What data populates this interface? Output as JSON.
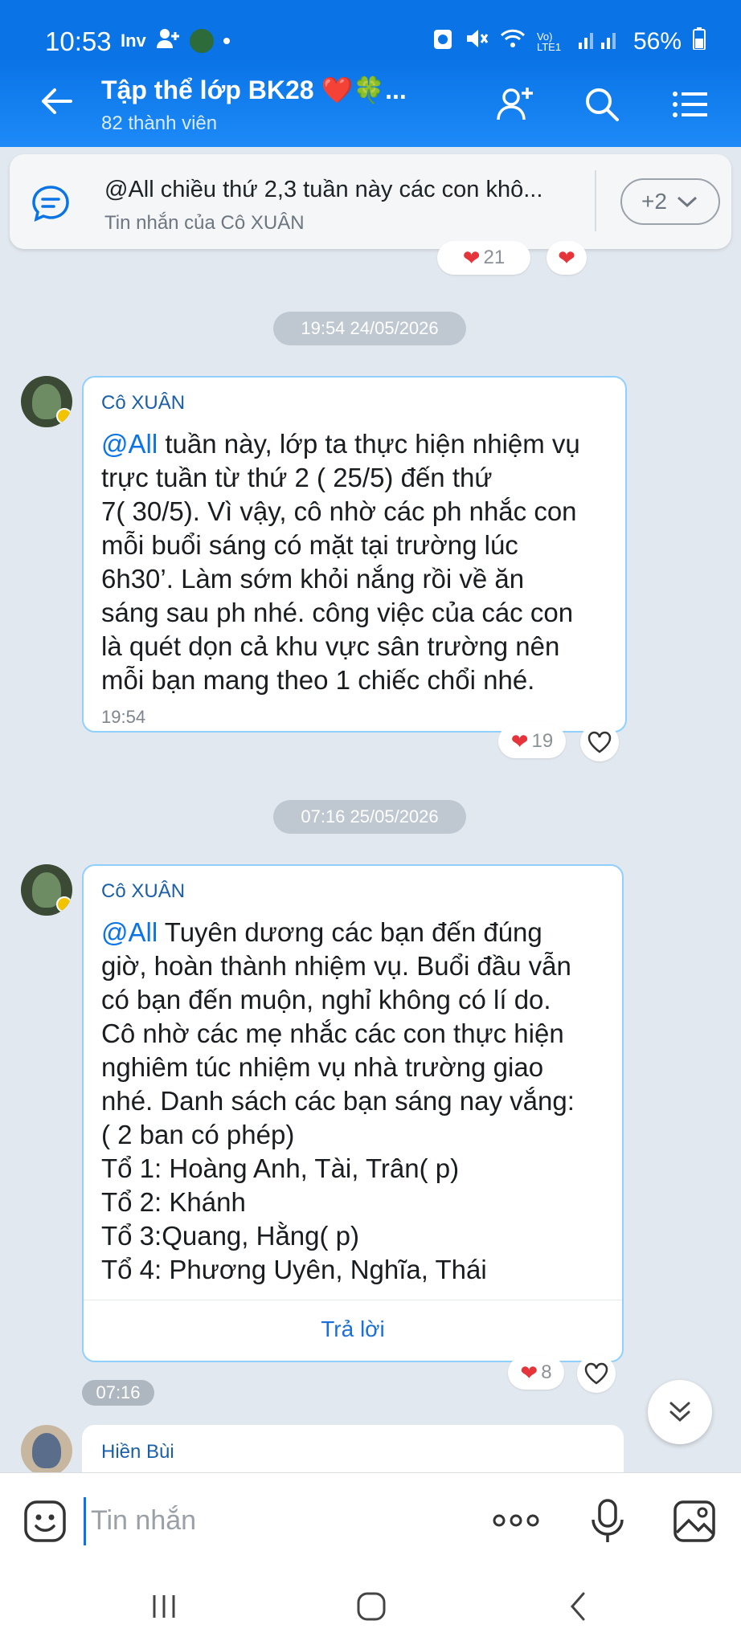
{
  "status_bar": {
    "time": "10:53",
    "left_text": "Inv",
    "right_text": "56%",
    "net_label": "Vo) LTE1"
  },
  "app_bar": {
    "title": "Tập thể lớp BK28 ❤️🍀...",
    "subtitle": "82 thành viên"
  },
  "pinned": {
    "text": "@All chiều thứ 2,3 tuần này các con khô...",
    "source": "Tin nhắn của Cô XUÂN",
    "more_label": "+2"
  },
  "top_reaction": {
    "count": "21"
  },
  "messages": [
    {
      "date": "19:54 24/05/2026",
      "sender": "Cô XUÂN",
      "mention": "@All",
      "text": " tuần này, lớp ta thực hiện nhiệm vụ\ntrực tuần từ thứ 2 ( 25/5) đến thứ\n7( 30/5). Vì vậy, cô nhờ các ph nhắc con\nmỗi buổi sáng có mặt tại trường lúc\n6h30’. Làm sớm khỏi nắng rồi về ăn\nsáng sau ph nhé. công việc của các con\nlà quét dọn cả khu vực sân trường nên\nmỗi bạn mang theo 1 chiếc chổi nhé.",
      "time": "19:54",
      "reactions": "19"
    },
    {
      "date": "07:16 25/05/2026",
      "sender": "Cô XUÂN",
      "mention": "@All",
      "text": " Tuyên dương các bạn đến đúng\ngiờ, hoàn thành nhiệm vụ. Buổi đầu vẫn\ncó bạn đến muộn, nghỉ không có lí do.\nCô nhờ các mẹ nhắc các con thực hiện\nnghiêm túc nhiệm vụ nhà trường giao\nnhé. Danh sách các bạn sáng nay vắng:\n( 2 ban có phép)\nTổ 1: Hoàng Anh, Tài, Trân( p)\nTổ 2: Khánh\nTổ 3:Quang,  Hằng( p)\nTổ 4: Phương Uyên, Nghĩa, Thái",
      "reply_label": "Trả lời",
      "time": "07:16",
      "reactions": "8"
    },
    {
      "sender": "Hiền Bùi"
    }
  ],
  "composer": {
    "placeholder": "Tin nhắn"
  }
}
